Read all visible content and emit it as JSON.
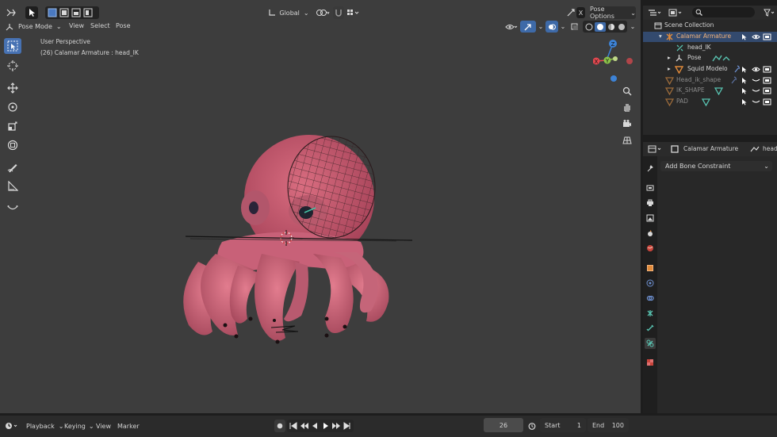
{
  "header": {
    "orientation_label": "Global",
    "pose_options_label": "Pose Options",
    "close_glyph": "X"
  },
  "menubar": {
    "mode_label": "Pose Mode",
    "view_label": "View",
    "select_label": "Select",
    "pose_label": "Pose"
  },
  "viewport": {
    "perspective_label": "User Perspective",
    "object_info": "(26) Calamar Armature : head_IK"
  },
  "gizmo": {
    "z_label": "Z",
    "y_label": "Y",
    "x_label": "X"
  },
  "outliner": {
    "search_placeholder": "",
    "root_label": "Scene Collection",
    "items": [
      {
        "label": "Calamar Armature"
      },
      {
        "label": "head_IK"
      },
      {
        "label": "Pose"
      },
      {
        "label": "Squid Modelo"
      },
      {
        "label": "Head_ik_shape"
      },
      {
        "label": "IK_SHAPE"
      },
      {
        "label": "PAD"
      }
    ]
  },
  "properties": {
    "breadcrumb_object": "Calamar Armature",
    "breadcrumb_bone": "head",
    "add_constraint_label": "Add Bone Constraint"
  },
  "timeline": {
    "playback_label": "Playback",
    "keying_label": "Keying",
    "view_label": "View",
    "marker_label": "Marker",
    "current_frame": "26",
    "start_label": "Start",
    "start_value": "1",
    "end_label": "End",
    "end_value": "100"
  },
  "colors": {
    "viewport_bg": "#3d3d3d",
    "accent_blue": "#3e6aa8",
    "axis_x": "#e3484f",
    "axis_y": "#8bc34a",
    "axis_z": "#3d83d6",
    "squid_body": "#c85a6e"
  }
}
